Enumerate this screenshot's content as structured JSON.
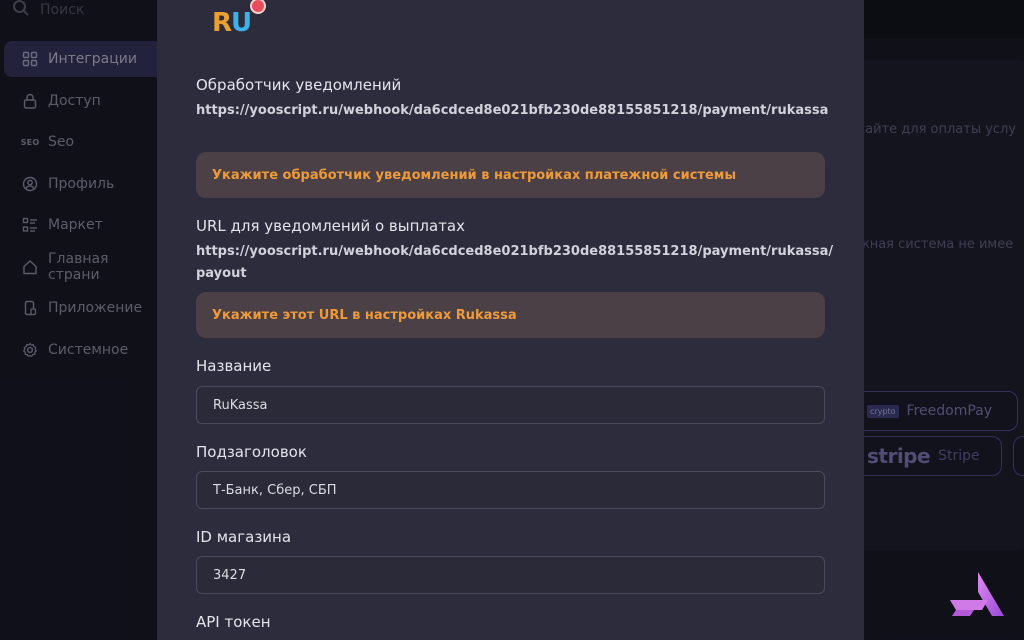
{
  "sidebar": {
    "search_label": "Поиск",
    "items": [
      {
        "label": "Интеграции",
        "icon": "integrations-icon",
        "active": true
      },
      {
        "label": "Доступ",
        "icon": "lock-icon"
      },
      {
        "label": "Seo",
        "icon": "seo-icon"
      },
      {
        "label": "Профиль",
        "icon": "profile-icon"
      },
      {
        "label": "Маркет",
        "icon": "market-icon"
      },
      {
        "label": "Главная страни",
        "icon": "home-icon"
      },
      {
        "label": "Приложение",
        "icon": "phone-icon"
      },
      {
        "label": "Системное",
        "icon": "gear-icon"
      }
    ],
    "seo_icon_text": "SEO"
  },
  "background": {
    "text1": "сайте для оплаты услу",
    "text2": "жная система не имее",
    "chips": [
      {
        "badge": "crypto",
        "label": "FreedomPay"
      },
      {
        "logo": "stripe",
        "label": "Stripe"
      }
    ]
  },
  "modal": {
    "logo_text_r": "R",
    "logo_text_u": "U",
    "webhook": {
      "label": "Обработчик уведомлений",
      "url": "https://yooscript.ru/webhook/da6cdced8e021bfb230de88155851218/payment/rukassa",
      "notice": "Укажите обработчик уведомлений в настройках платежной системы"
    },
    "payout": {
      "label": "URL для уведомлений о выплатах",
      "url": "https://yooscript.ru/webhook/da6cdced8e021bfb230de88155851218/payment/rukassa/payout",
      "notice": "Укажите этот URL в настройках Rukassa"
    },
    "fields": {
      "name": {
        "label": "Название",
        "value": "RuKassa"
      },
      "subtitle": {
        "label": "Подзаголовок",
        "value": "Т-Банк, Сбер, СБП"
      },
      "shop_id": {
        "label": "ID магазина",
        "value": "3427"
      },
      "api_token": {
        "label": "API токен"
      }
    }
  },
  "colors": {
    "accent": "#3b3a64",
    "notice_text": "#ef9a3a",
    "brand": "#c86ae0"
  }
}
